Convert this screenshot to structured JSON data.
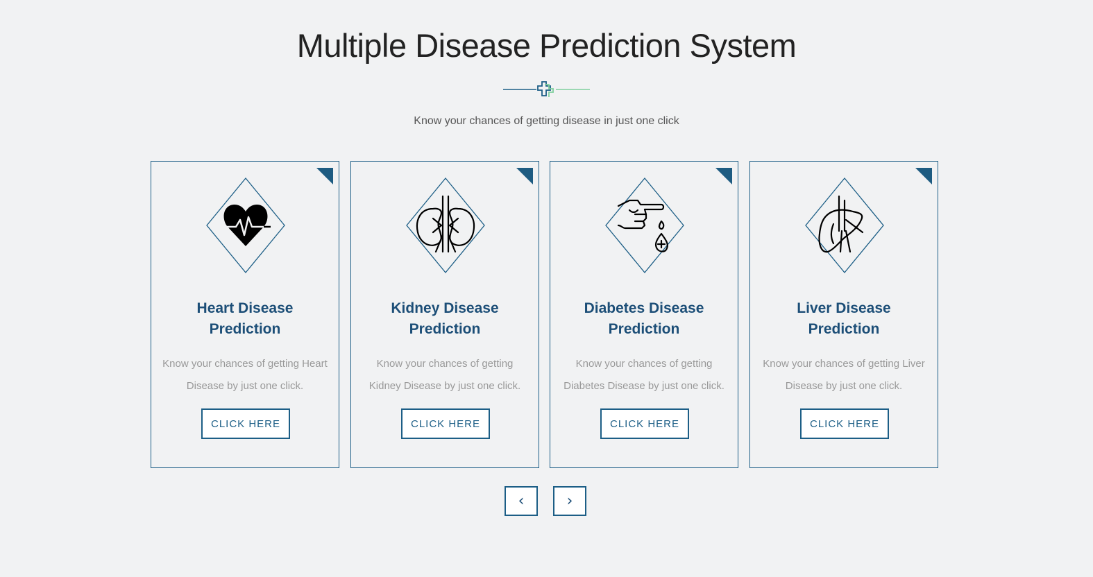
{
  "header": {
    "title": "Multiple Disease Prediction System",
    "subtitle": "Know your chances of getting disease in just one click"
  },
  "cards": [
    {
      "title_line1": "Heart Disease",
      "title_line2": "Prediction",
      "desc_line1": "Know your chances of getting Heart",
      "desc_line2": "Disease by just one click.",
      "button_label": "CLICK HERE",
      "icon": "heart-pulse-icon"
    },
    {
      "title_line1": "Kidney Disease",
      "title_line2": "Prediction",
      "desc_line1": "Know your chances of getting",
      "desc_line2": "Kidney Disease by just one click.",
      "button_label": "CLICK HERE",
      "icon": "kidney-icon"
    },
    {
      "title_line1": "Diabetes Disease",
      "title_line2": "Prediction",
      "desc_line1": "Know your chances of getting",
      "desc_line2": "Diabetes Disease by just one click.",
      "button_label": "CLICK HERE",
      "icon": "blood-drop-finger-icon"
    },
    {
      "title_line1": "Liver Disease",
      "title_line2": "Prediction",
      "desc_line1": "Know your chances of getting Liver",
      "desc_line2": "Disease by just one click.",
      "button_label": "CLICK HERE",
      "icon": "liver-icon"
    }
  ],
  "carousel": {
    "prev_label": "‹",
    "next_label": "›"
  },
  "colors": {
    "background": "#f1f2f3",
    "accent": "#1c5e86",
    "title_blue": "#1c4e77",
    "divider_green": "#7fcf9d"
  }
}
